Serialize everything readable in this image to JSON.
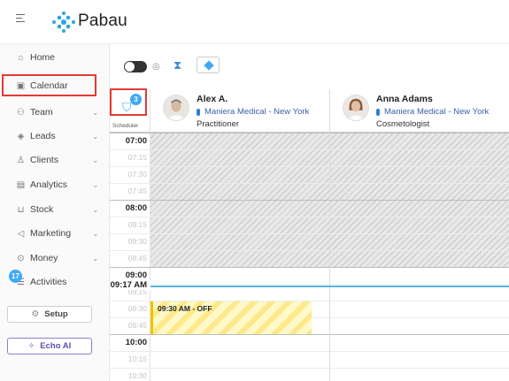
{
  "brand": {
    "name": "Pabau"
  },
  "sidebar": {
    "items": [
      {
        "label": "Home",
        "icon": "home-icon",
        "chevron": false
      },
      {
        "label": "Calendar",
        "icon": "calendar-icon",
        "chevron": false
      },
      {
        "label": "Team",
        "icon": "team-icon",
        "chevron": true
      },
      {
        "label": "Leads",
        "icon": "leads-icon",
        "chevron": true
      },
      {
        "label": "Clients",
        "icon": "clients-icon",
        "chevron": true
      },
      {
        "label": "Analytics",
        "icon": "analytics-icon",
        "chevron": true
      },
      {
        "label": "Stock",
        "icon": "cart-icon",
        "chevron": true
      },
      {
        "label": "Marketing",
        "icon": "megaphone-icon",
        "chevron": true
      },
      {
        "label": "Money",
        "icon": "money-icon",
        "chevron": true
      },
      {
        "label": "Activities",
        "icon": "activities-icon",
        "chevron": false,
        "badge": "17"
      }
    ],
    "setup_label": "Setup",
    "echo_label": "Echo AI"
  },
  "calendar": {
    "filter_badge": "3",
    "scheduler_label": "Scheduler",
    "staff": [
      {
        "name": "Alex A.",
        "location": "Maniera Medical - New York",
        "role": "Practitioner"
      },
      {
        "name": "Anna Adams",
        "location": "Maniera Medical - New York",
        "role": "Cosmetologist"
      }
    ],
    "times": [
      {
        "label": "07:00",
        "hour": true
      },
      {
        "label": "07:15",
        "hour": false
      },
      {
        "label": "07:30",
        "hour": false
      },
      {
        "label": "07:45",
        "hour": false
      },
      {
        "label": "08:00",
        "hour": true
      },
      {
        "label": "08:15",
        "hour": false
      },
      {
        "label": "09:30",
        "hour": false
      },
      {
        "label": "08:45",
        "hour": false
      },
      {
        "label": "09:00",
        "hour": true
      },
      {
        "label": "09:15",
        "hour": false
      },
      {
        "label": "09:30",
        "hour": false
      },
      {
        "label": "09:45",
        "hour": false
      },
      {
        "label": "10:00",
        "hour": true
      },
      {
        "label": "10:15",
        "hour": false
      },
      {
        "label": "10:30",
        "hour": false
      }
    ],
    "now_label": "09:17 AM",
    "event": {
      "label": "09:30 AM - OFF",
      "color": "#f0c200"
    },
    "accent_color": "#3fa9f5",
    "highlight_color": "#e53935"
  }
}
